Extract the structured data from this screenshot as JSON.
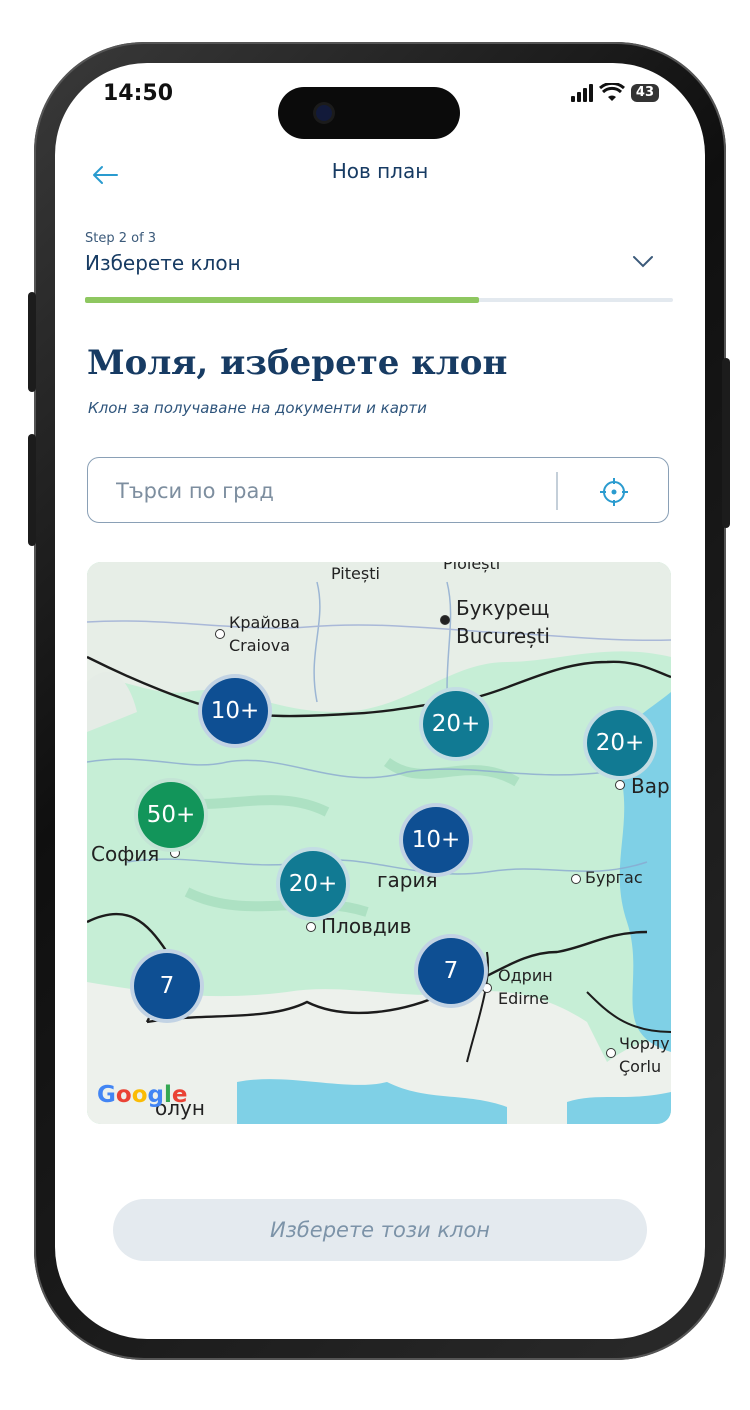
{
  "status": {
    "time": "14:50",
    "battery": "43"
  },
  "header": {
    "title": "Нов план"
  },
  "step": {
    "counter": "Step 2 of 3",
    "name": "Изберете клон",
    "progress_fraction": 0.67
  },
  "main": {
    "heading": "Моля, изберете клон",
    "subheading": "Клон за получаване на документи и карти",
    "search_placeholder": "Търси по град"
  },
  "map": {
    "places": [
      "Pitești",
      "Ploiești",
      "Букурещ",
      "București",
      "Крайова",
      "Craiova",
      "София",
      "гария",
      "Бургас",
      "Пловдив",
      "Одрин",
      "Edirne",
      "Чорлу",
      "Çorlu",
      "олун",
      "Вар"
    ],
    "clusters": [
      {
        "label": "10+",
        "color": "#0e4f93"
      },
      {
        "label": "20+",
        "color": "#117a93"
      },
      {
        "label": "20+",
        "color": "#117a93"
      },
      {
        "label": "50+",
        "color": "#12955a"
      },
      {
        "label": "10+",
        "color": "#0e4f93"
      },
      {
        "label": "20+",
        "color": "#117a93"
      },
      {
        "label": "7",
        "color": "#0e4f93"
      },
      {
        "label": "7",
        "color": "#0e4f93"
      }
    ],
    "attribution": "Google"
  },
  "footer": {
    "cta_label": "Изберете този клон"
  },
  "colors": {
    "brand_navy": "#173b63",
    "progress": "#8ec760",
    "teal": "#117a93",
    "blue": "#0e4f93",
    "green": "#12955a"
  }
}
